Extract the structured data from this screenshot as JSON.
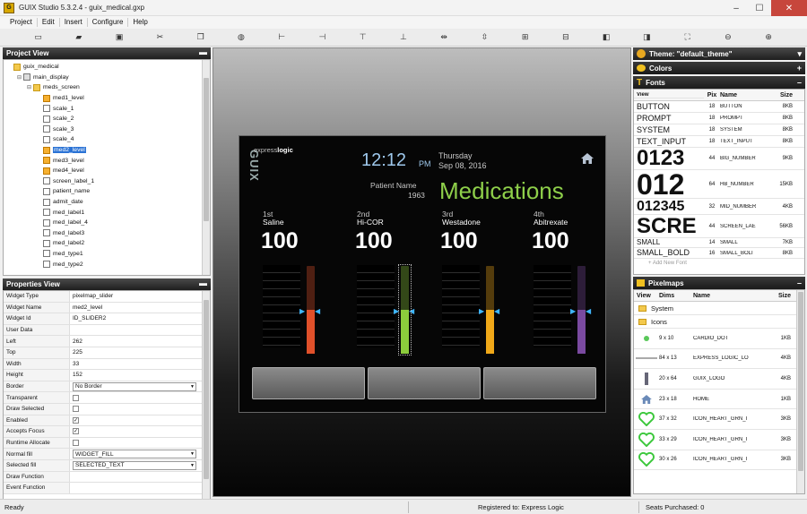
{
  "window": {
    "title": "GUIX Studio 5.3.2.4 - guix_medical.gxp",
    "icon_letter": "G",
    "min": "–",
    "max": "☐",
    "close": "✕"
  },
  "menu": [
    "Project",
    "Edit",
    "Insert",
    "Configure",
    "Help"
  ],
  "toolbar_icons": [
    "new-icon",
    "open-icon",
    "save-icon",
    "cut-icon",
    "copy-icon",
    "paste-icon",
    "align-left-icon",
    "align-right-icon",
    "align-top-icon",
    "align-bottom-icon",
    "center-h-icon",
    "center-v-icon",
    "equal-width-icon",
    "equal-height-icon",
    "move-front-icon",
    "move-back-icon",
    "size-to-fit-icon",
    "zoom-out-icon",
    "zoom-in-icon"
  ],
  "project_view": {
    "title": "Project View",
    "pin": "▬",
    "items": [
      {
        "label": "guix_medical",
        "icon": "folder",
        "indent": 0,
        "exp": ""
      },
      {
        "label": "main_display",
        "icon": "disp",
        "indent": 1,
        "exp": "⊟"
      },
      {
        "label": "meds_screen",
        "icon": "folder",
        "indent": 2,
        "exp": "⊟"
      },
      {
        "label": "med1_level",
        "icon": "level",
        "indent": 3,
        "exp": ""
      },
      {
        "label": "scale_1",
        "icon": "scale",
        "indent": 3,
        "exp": ""
      },
      {
        "label": "scale_2",
        "icon": "scale",
        "indent": 3,
        "exp": ""
      },
      {
        "label": "scale_3",
        "icon": "scale",
        "indent": 3,
        "exp": ""
      },
      {
        "label": "scale_4",
        "icon": "scale",
        "indent": 3,
        "exp": ""
      },
      {
        "label": "med2_level",
        "icon": "level",
        "indent": 3,
        "exp": "",
        "selected": true
      },
      {
        "label": "med3_level",
        "icon": "level",
        "indent": 3,
        "exp": ""
      },
      {
        "label": "med4_level",
        "icon": "level",
        "indent": 3,
        "exp": ""
      },
      {
        "label": "screen_label_1",
        "icon": "scale",
        "indent": 3,
        "exp": ""
      },
      {
        "label": "patient_name",
        "icon": "scale",
        "indent": 3,
        "exp": ""
      },
      {
        "label": "admit_date",
        "icon": "scale",
        "indent": 3,
        "exp": ""
      },
      {
        "label": "med_label1",
        "icon": "scale",
        "indent": 3,
        "exp": ""
      },
      {
        "label": "med_label_4",
        "icon": "scale",
        "indent": 3,
        "exp": ""
      },
      {
        "label": "med_label3",
        "icon": "scale",
        "indent": 3,
        "exp": ""
      },
      {
        "label": "med_label2",
        "icon": "scale",
        "indent": 3,
        "exp": ""
      },
      {
        "label": "med_type1",
        "icon": "scale",
        "indent": 3,
        "exp": ""
      },
      {
        "label": "med_type2",
        "icon": "scale",
        "indent": 3,
        "exp": ""
      }
    ]
  },
  "properties_view": {
    "title": "Properties View",
    "pin": "▬",
    "rows": [
      {
        "key": "Widget Type",
        "type": "text",
        "value": "pixelmap_slider"
      },
      {
        "key": "Widget Name",
        "type": "text",
        "value": "med2_level"
      },
      {
        "key": "Widget Id",
        "type": "text",
        "value": "ID_SLIDER2"
      },
      {
        "key": "User Data",
        "type": "text",
        "value": ""
      },
      {
        "key": "Left",
        "type": "text",
        "value": "262"
      },
      {
        "key": "Top",
        "type": "text",
        "value": "225"
      },
      {
        "key": "Width",
        "type": "text",
        "value": "33"
      },
      {
        "key": "Height",
        "type": "text",
        "value": "152"
      },
      {
        "key": "Border",
        "type": "select",
        "value": "No Border"
      },
      {
        "key": "Transparent",
        "type": "check",
        "value": ""
      },
      {
        "key": "Draw Selected",
        "type": "check",
        "value": ""
      },
      {
        "key": "Enabled",
        "type": "check",
        "value": "✓"
      },
      {
        "key": "Accepts Focus",
        "type": "check",
        "value": "✓"
      },
      {
        "key": "Runtime Allocate",
        "type": "check",
        "value": ""
      },
      {
        "key": "Normal fill",
        "type": "select",
        "value": "WIDGET_FILL"
      },
      {
        "key": "Selected fill",
        "type": "select",
        "value": "SELECTED_TEXT"
      },
      {
        "key": "Draw Function",
        "type": "text",
        "value": ""
      },
      {
        "key": "Event Function",
        "type": "text",
        "value": ""
      }
    ]
  },
  "screen": {
    "logo_prefix": "express",
    "logo_suffix": "logic",
    "guix": "GUIX",
    "time": "12:12",
    "ampm": "PM",
    "day": "Thursday",
    "date": "Sep 08, 2016",
    "patient_label": "Patient Name",
    "patient_year": "1963",
    "title": "Medications",
    "meds": [
      {
        "ord": "1st",
        "name": "Saline",
        "value": "100",
        "color": "#e0502a",
        "level": 0.5
      },
      {
        "ord": "2nd",
        "name": "Hi-COR",
        "value": "100",
        "color": "#8ccc3c",
        "level": 0.5
      },
      {
        "ord": "3rd",
        "name": "Westadone",
        "value": "100",
        "color": "#f0a818",
        "level": 0.5
      },
      {
        "ord": "4th",
        "name": "Abitrexate",
        "value": "100",
        "color": "#7a4aa0",
        "level": 0.5
      }
    ]
  },
  "right": {
    "theme": "Theme: \"default_theme\"",
    "colors": "Colors",
    "fonts": "Fonts",
    "pixelmaps": "Pixelmaps",
    "font_cols": [
      "View",
      "Pix",
      "Name",
      "Size"
    ],
    "font_rows": [
      {
        "view": "BUTTON",
        "pix": "18",
        "name": "BUTTON",
        "size": "8KB",
        "h": 13,
        "fs": 9
      },
      {
        "view": "PROMPT",
        "pix": "18",
        "name": "PROMPT",
        "size": "8KB",
        "h": 13,
        "fs": 9
      },
      {
        "view": "SYSTEM",
        "pix": "18",
        "name": "SYSTEM",
        "size": "8KB",
        "h": 13,
        "fs": 9
      },
      {
        "view": "TEXT_INPUT",
        "pix": "18",
        "name": "TEXT_INPUT",
        "size": "8KB",
        "h": 13,
        "fs": 9
      },
      {
        "view": "0123",
        "pix": "44",
        "name": "BIG_NUMBER",
        "size": "9KB",
        "h": 25,
        "fs": 24
      },
      {
        "view": "012",
        "pix": "64",
        "name": "HB_NUMBER",
        "size": "15KB",
        "h": 32,
        "fs": 32
      },
      {
        "view": "012345",
        "pix": "32",
        "name": "MID_NUMBER",
        "size": "4KB",
        "h": 18,
        "fs": 16
      },
      {
        "view": "SCRE",
        "pix": "44",
        "name": "SCREEN_LAE",
        "size": "56KB",
        "h": 26,
        "fs": 24
      },
      {
        "view": "SMALL",
        "pix": "14",
        "name": "SMALL",
        "size": "7KB",
        "h": 11,
        "fs": 8
      },
      {
        "view": "SMALL_BOLD",
        "pix": "16",
        "name": "SMALL_BOLI",
        "size": "8KB",
        "h": 12,
        "fs": 9
      }
    ],
    "add_font": "+ Add New Font",
    "pix_cols": [
      "View",
      "Dims",
      "Name",
      "Size"
    ],
    "groups": [
      "System",
      "Icons"
    ],
    "pix_rows": [
      {
        "icon": "cardio-dot-icon",
        "dims": "9 x 10",
        "name": "CARDIO_DOT",
        "size": "1KB"
      },
      {
        "icon": "express-logic-logo-icon",
        "dims": "84 x 13",
        "name": "EXPRESS_LOGIC_LO",
        "size": "4KB"
      },
      {
        "icon": "guix-logo-icon",
        "dims": "20 x 64",
        "name": "GUIX_LOGO",
        "size": "4KB"
      },
      {
        "icon": "home-icon",
        "dims": "23 x 18",
        "name": "HOME",
        "size": "1KB"
      },
      {
        "icon": "heart-icon",
        "dims": "37 x 32",
        "name": "ICON_HEART_GRN_I",
        "size": "3KB"
      },
      {
        "icon": "heart-icon",
        "dims": "33 x 29",
        "name": "ICON_HEART_GRN_I",
        "size": "3KB"
      },
      {
        "icon": "heart-icon",
        "dims": "30 x 26",
        "name": "ICON_HEART_GRN_I",
        "size": "3KB"
      }
    ]
  },
  "status": {
    "left": "Ready",
    "middle": "Registered to: Express Logic",
    "right": "Seats Purchased: 0"
  }
}
